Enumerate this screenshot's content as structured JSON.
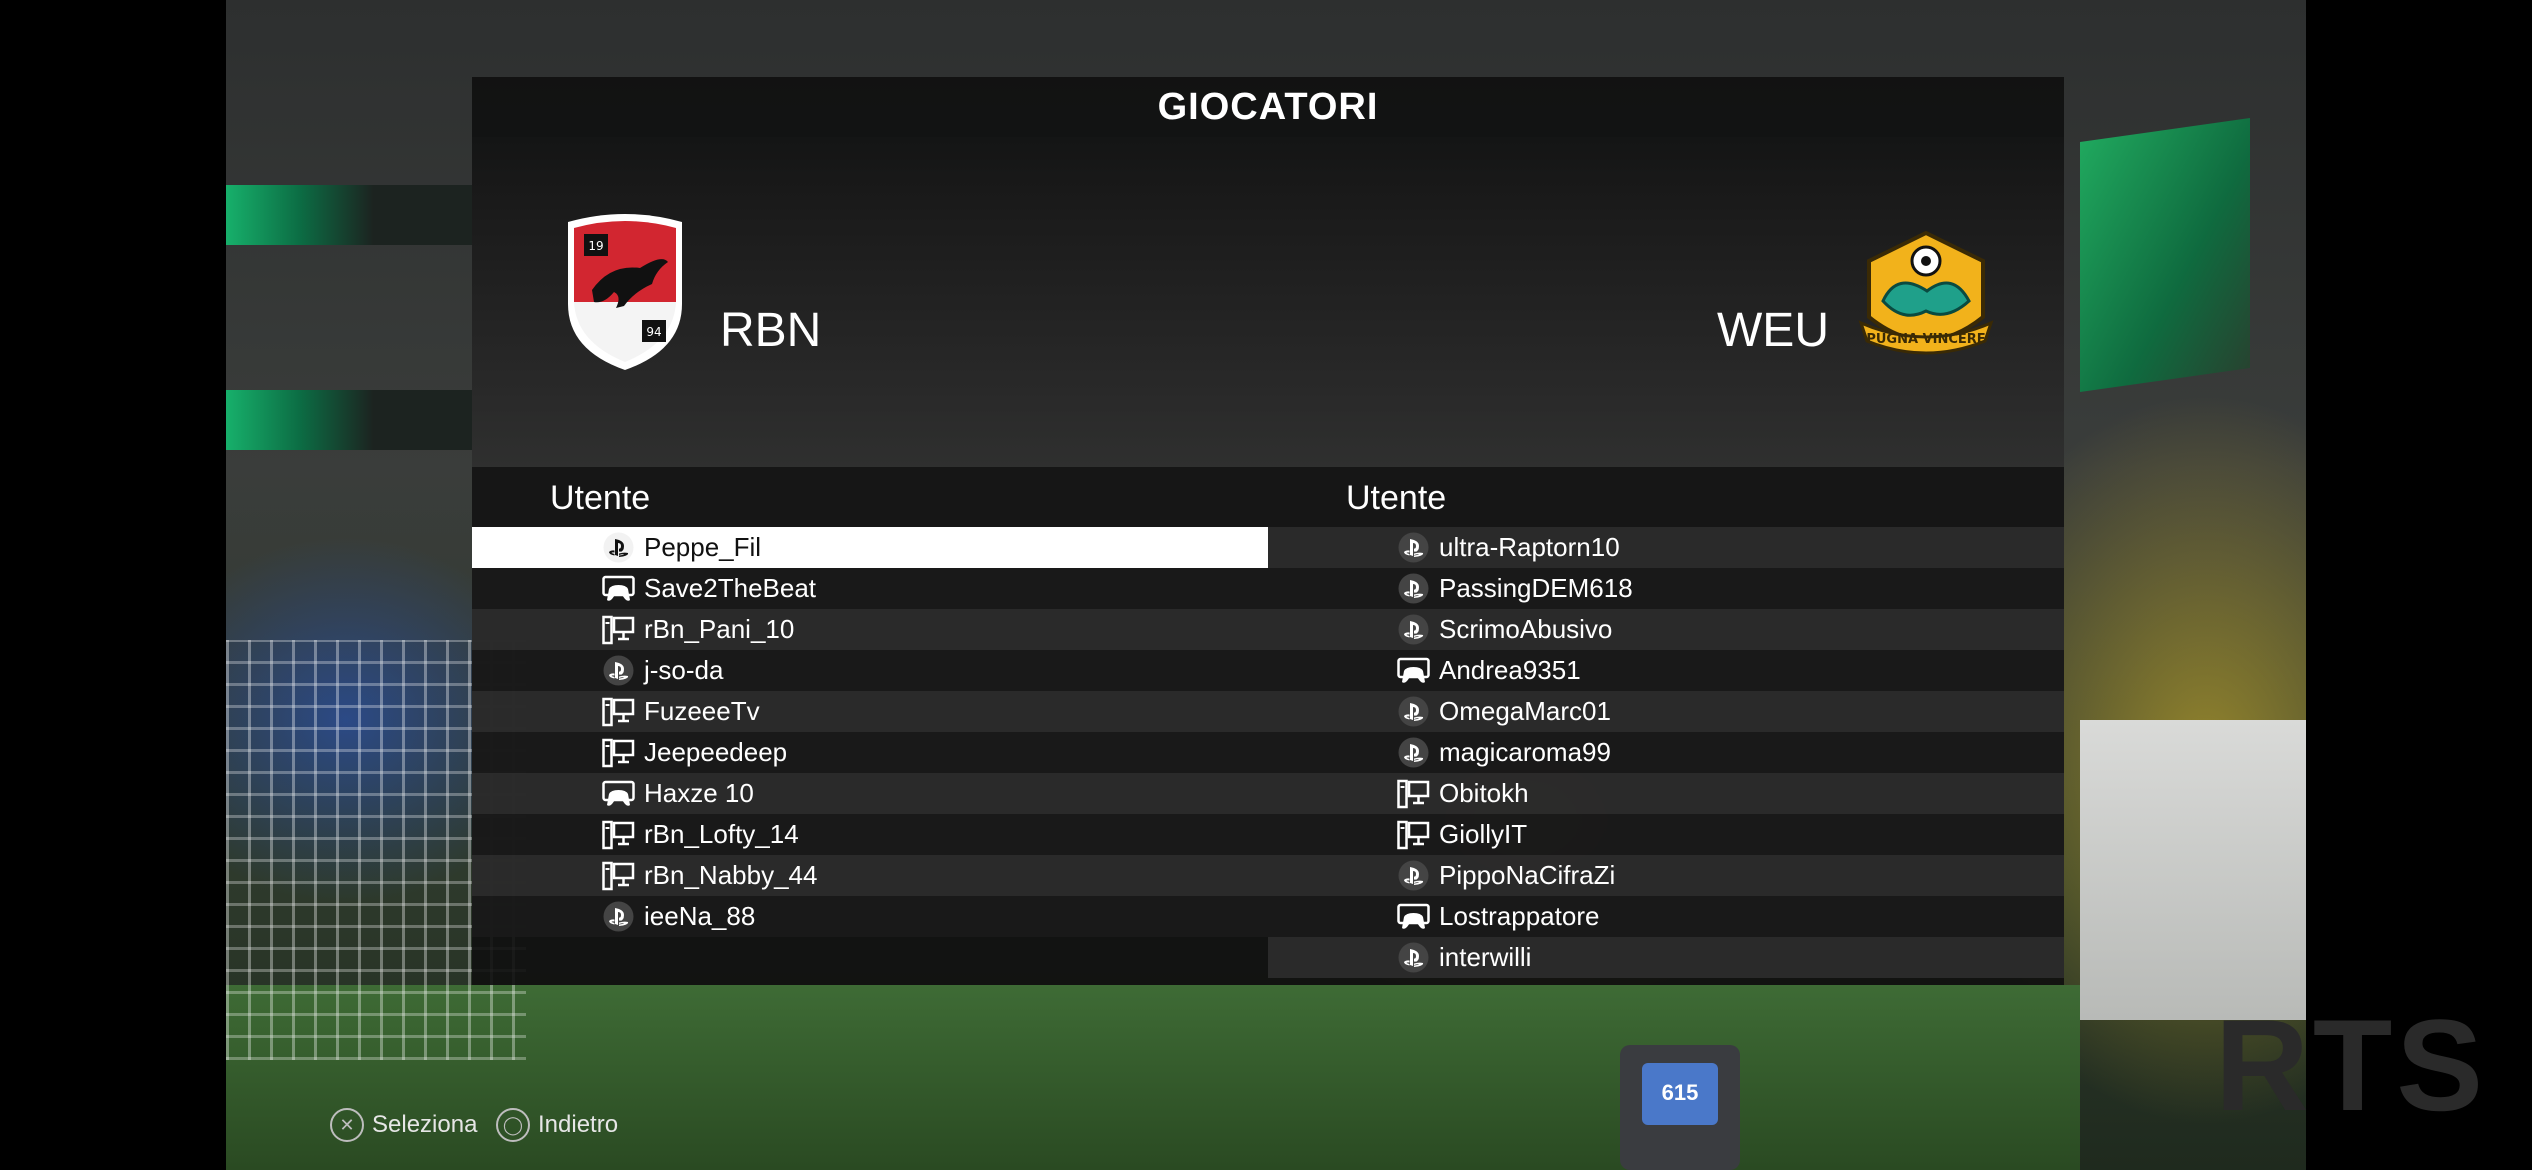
{
  "screen": {
    "title": "GIOCATORI"
  },
  "teams": {
    "home": {
      "name": "RBN",
      "crest_numbers": [
        "19",
        "94"
      ]
    },
    "away": {
      "name": "WEU",
      "crest_text": "PUGNA VINCERE"
    }
  },
  "columns": {
    "home_header": "Utente",
    "away_header": "Utente"
  },
  "home_players": [
    {
      "name": "Peppe_Fil",
      "platform": "playstation-icon",
      "selected": true
    },
    {
      "name": "Save2TheBeat",
      "platform": "xbox-controller-icon"
    },
    {
      "name": "rBn_Pani_10",
      "platform": "pc-icon"
    },
    {
      "name": "j-so-da",
      "platform": "playstation-icon"
    },
    {
      "name": "FuzeeeTv",
      "platform": "pc-icon"
    },
    {
      "name": "Jeepeedeep",
      "platform": "pc-icon"
    },
    {
      "name": "Haxze 10",
      "platform": "xbox-controller-icon"
    },
    {
      "name": "rBn_Lofty_14",
      "platform": "pc-icon"
    },
    {
      "name": "rBn_Nabby_44",
      "platform": "pc-icon"
    },
    {
      "name": "ieeNa_88",
      "platform": "playstation-icon"
    }
  ],
  "away_players": [
    {
      "name": "ultra-Raptorn10",
      "platform": "playstation-icon"
    },
    {
      "name": "PassingDEM618",
      "platform": "playstation-icon"
    },
    {
      "name": "ScrimoAbusivo",
      "platform": "playstation-icon"
    },
    {
      "name": "Andrea9351",
      "platform": "xbox-controller-icon"
    },
    {
      "name": "OmegaMarc01",
      "platform": "playstation-icon"
    },
    {
      "name": "magicaroma99",
      "platform": "playstation-icon"
    },
    {
      "name": "Obitokh",
      "platform": "pc-icon"
    },
    {
      "name": "GiollyIT",
      "platform": "pc-icon"
    },
    {
      "name": "PippoNaCifraZi",
      "platform": "playstation-icon"
    },
    {
      "name": "Lostrappatore",
      "platform": "xbox-controller-icon"
    },
    {
      "name": "interwilli",
      "platform": "playstation-icon"
    }
  ],
  "footer": {
    "select_label": "Seleziona",
    "back_label": "Indietro",
    "select_button": "cross-button-icon",
    "back_button": "circle-button-icon"
  },
  "background": {
    "battery_label": "615"
  },
  "colors": {
    "panel": "#101010",
    "selected_row": "#ffffff",
    "home_crest_red": "#d22630",
    "away_crest_gold": "#f2b21b"
  }
}
